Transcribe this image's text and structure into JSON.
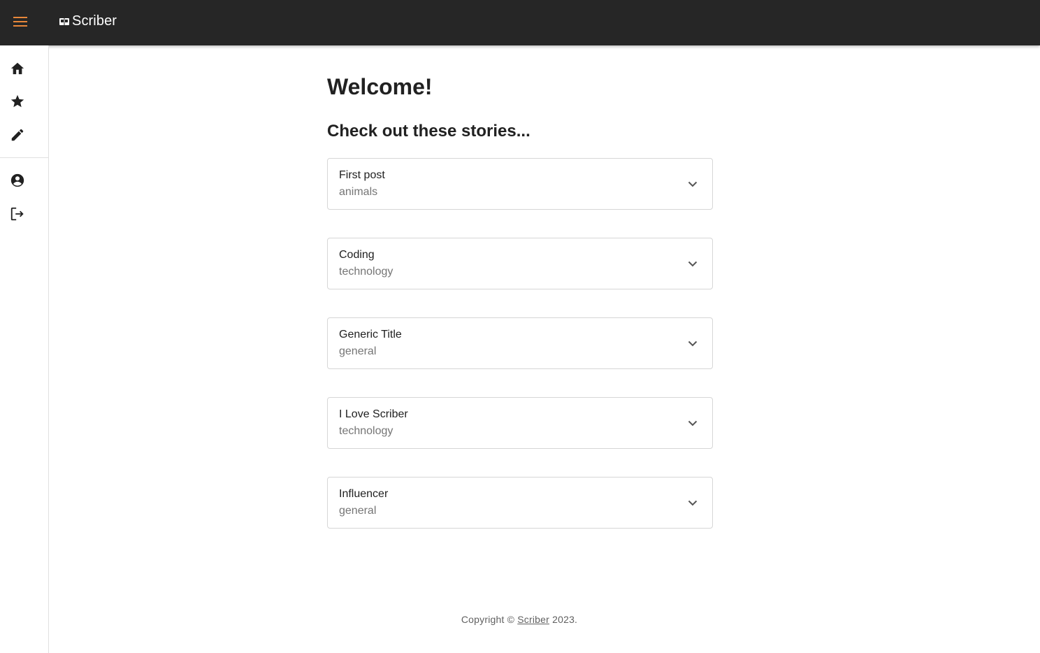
{
  "app": {
    "name": "Scriber",
    "accent_color": "#e8873a",
    "topbar_color": "#262626"
  },
  "topbar": {
    "menu_icon": "hamburger-menu-icon",
    "logo_icon": "book-open-icon"
  },
  "sidebar": {
    "items": [
      {
        "name": "home",
        "icon": "home-icon"
      },
      {
        "name": "favorites",
        "icon": "star-icon"
      },
      {
        "name": "write",
        "icon": "pencil-icon"
      },
      {
        "name": "account",
        "icon": "account-circle-icon"
      },
      {
        "name": "logout",
        "icon": "logout-icon"
      }
    ]
  },
  "main": {
    "welcome": "Welcome!",
    "subtitle": "Check out these stories...",
    "stories": [
      {
        "title": "First post",
        "category": "animals"
      },
      {
        "title": "Coding",
        "category": "technology"
      },
      {
        "title": "Generic Title",
        "category": "general"
      },
      {
        "title": "I Love Scriber",
        "category": "technology"
      },
      {
        "title": "Influencer",
        "category": "general"
      }
    ]
  },
  "footer": {
    "prefix": "Copyright © ",
    "link": "Scriber",
    "suffix": " 2023."
  }
}
